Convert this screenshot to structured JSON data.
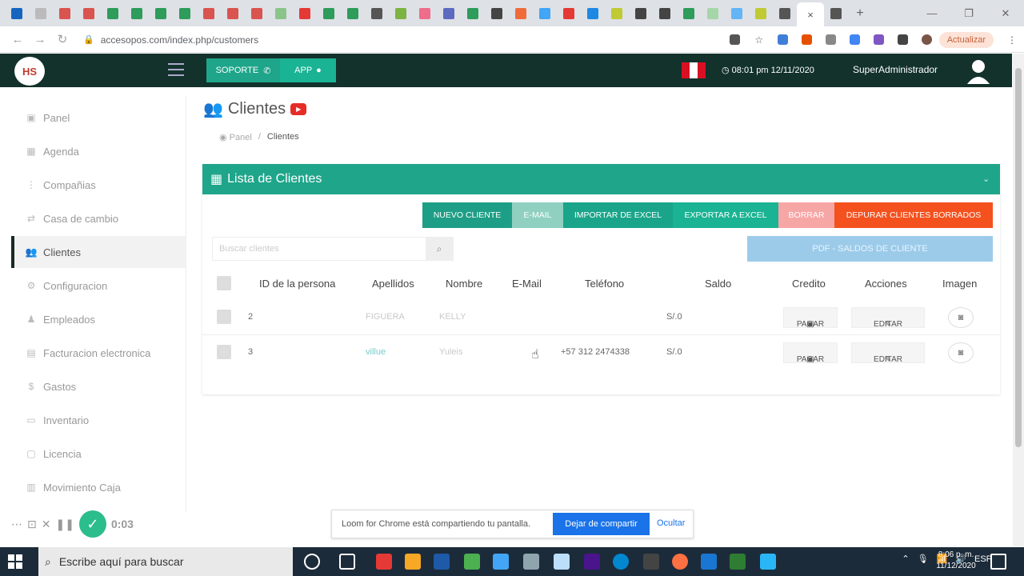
{
  "browser": {
    "url": "accesopos.com/index.php/customers",
    "profile_label": "Actualizar",
    "active_tab_close": "×",
    "new_tab": "+"
  },
  "header": {
    "logo_text": "HS",
    "soporte_label": "SOPORTE",
    "app_label": "APP",
    "datetime": "08:01 pm 12/11/2020",
    "user_name": "SuperAdministrador"
  },
  "sidebar": {
    "items": [
      {
        "label": "Panel",
        "icon": "dashboard-icon"
      },
      {
        "label": "Agenda",
        "icon": "calendar-icon"
      },
      {
        "label": "Compañias",
        "icon": "company-icon"
      },
      {
        "label": "Casa de cambio",
        "icon": "exchange-icon"
      },
      {
        "label": "Clientes",
        "icon": "users-icon"
      },
      {
        "label": "Configuracion",
        "icon": "settings-icon"
      },
      {
        "label": "Empleados",
        "icon": "employee-icon"
      },
      {
        "label": "Facturacion electronica",
        "icon": "invoice-icon"
      },
      {
        "label": "Gastos",
        "icon": "money-icon"
      },
      {
        "label": "Inventario",
        "icon": "box-icon"
      },
      {
        "label": "Licencia",
        "icon": "license-icon"
      },
      {
        "label": "Movimiento Caja",
        "icon": "cash-icon"
      }
    ]
  },
  "page": {
    "title": "Clientes",
    "breadcrumb_home": "Panel",
    "breadcrumb_current": "Clientes"
  },
  "panel": {
    "title": "Lista de Clientes",
    "buttons": {
      "nuevo": "NUEVO CLIENTE",
      "email": "E-MAIL",
      "importar": "IMPORTAR DE EXCEL",
      "exportar": "EXPORTAR A EXCEL",
      "borrar": "BORRAR",
      "depurar": "DEPURAR CLIENTES BORRADOS",
      "pdf": "PDF - SALDOS DE CLIENTE"
    },
    "search_placeholder": "Buscar clientes",
    "columns": [
      "ID de la persona",
      "Apellidos",
      "Nombre",
      "E-Mail",
      "Teléfono",
      "Saldo",
      "Credito",
      "Acciones",
      "Imagen"
    ],
    "rows": [
      {
        "id": "2",
        "apellidos": "FIGUERA",
        "nombre": "KELLY",
        "email": "",
        "telefono": "",
        "saldo": "S/.0",
        "pagar": "PAGAR",
        "editar": "EDITAR"
      },
      {
        "id": "3",
        "apellidos": "villue",
        "nombre": "Yuleis",
        "email": "",
        "telefono": "+57 312 2474338",
        "saldo": "S/.0",
        "pagar": "PAGAR",
        "editar": "EDITAR"
      }
    ]
  },
  "loom": {
    "timer": "0:03",
    "share_text": "Loom for Chrome está compartiendo tu pantalla.",
    "stop_label": "Dejar de compartir",
    "hide_label": "Ocultar"
  },
  "taskbar": {
    "search_text": "Escribe aquí para buscar",
    "lang": "ESP",
    "time": "8:06 p. m.",
    "date": "11/12/2020"
  },
  "colors": {
    "brand_dark": "#12322b",
    "brand_green": "#1fa58a",
    "danger": "#f4511e",
    "info": "#9ccbea"
  }
}
